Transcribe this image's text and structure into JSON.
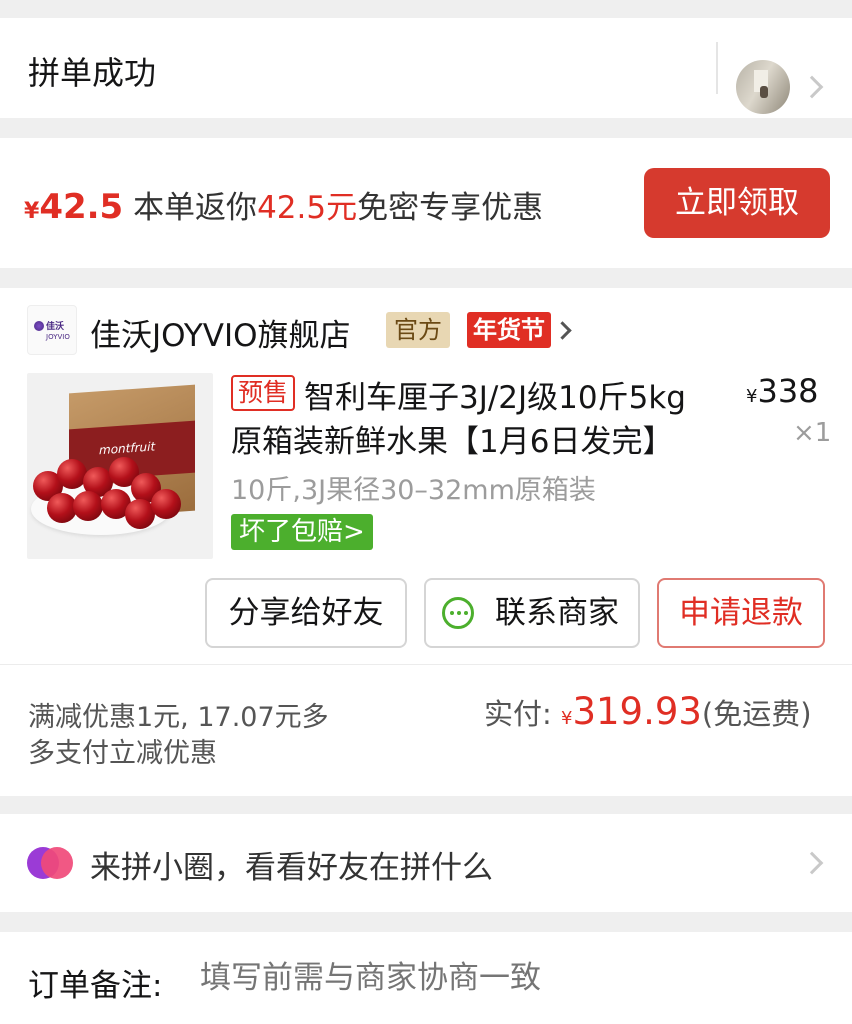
{
  "status": {
    "title": "拼单成功"
  },
  "coupon": {
    "currency": "¥",
    "amount": "42.5",
    "text_pre": "本单返你",
    "text_amount": "42.5元",
    "text_post": "免密专享优惠",
    "button": "立即领取"
  },
  "store": {
    "logo_cn": "佳沃",
    "logo_en": "JOYVIO",
    "name": "佳沃JOYVIO旗舰店",
    "badge_official": "官方",
    "badge_festival": "年货节"
  },
  "product": {
    "presale": "预售",
    "title_line1": "智利车厘子3J/2J级10斤5kg",
    "title_line2": "原箱装新鲜水果【1月6日发完】",
    "price_currency": "¥",
    "price": "338",
    "quantity": "×1",
    "spec": "10斤,3J果径30–32mm原箱装",
    "guarantee": "坏了包赔>",
    "image_brand": "montfruit"
  },
  "actions": {
    "share": "分享给好友",
    "contact": "联系商家",
    "refund": "申请退款"
  },
  "summary": {
    "discount_line1": "满减优惠1元, 17.07元多",
    "discount_line2": "多支付立减优惠",
    "paid_label": "实付:",
    "paid_currency": "¥",
    "paid_amount": "319.93",
    "shipping_note": "(免运费)"
  },
  "circle": {
    "text": "来拼小圈，看看好友在拼什么"
  },
  "remark": {
    "label": "订单备注:",
    "placeholder": "填写前需与商家协商一致"
  },
  "colors": {
    "accent_red": "#e02e24",
    "button_red": "#d63a2e",
    "green": "#4caf2d",
    "gold": "#e8d7b3"
  }
}
